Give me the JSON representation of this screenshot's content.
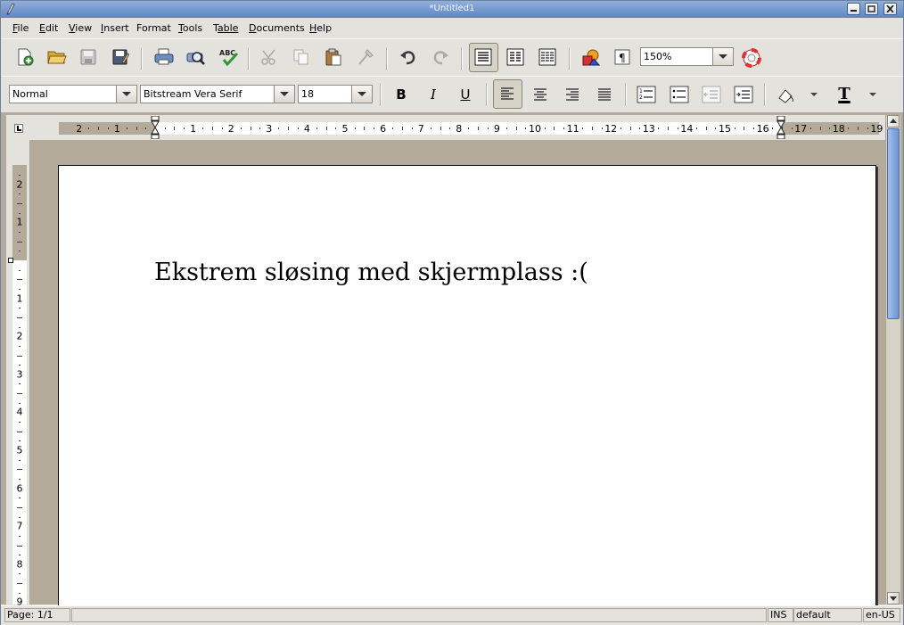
{
  "window": {
    "title": "*Untitled1"
  },
  "menu": {
    "items": [
      {
        "key": "F",
        "rest": "ile"
      },
      {
        "key": "E",
        "rest": "dit"
      },
      {
        "key": "V",
        "rest": "iew"
      },
      {
        "key": "I",
        "rest": "nsert"
      },
      {
        "key": "F",
        "rest": "ormat",
        "pre": "",
        "underline_index": 1
      },
      {
        "key": "T",
        "rest": "ools"
      },
      {
        "key": "T",
        "rest": "able"
      },
      {
        "key": "D",
        "rest": "ocuments"
      },
      {
        "key": "H",
        "rest": "elp"
      }
    ]
  },
  "toolbar": {
    "zoom_value": "150%",
    "icons": [
      "new-document-icon",
      "open-folder-icon",
      "save-icon",
      "save-as-icon",
      "print-icon",
      "print-preview-icon",
      "spell-check-icon",
      "cut-icon",
      "copy-icon",
      "paste-icon",
      "format-painter-icon",
      "undo-icon",
      "redo-icon",
      "normal-layout-icon",
      "web-layout-icon",
      "outline-layout-icon",
      "insert-picture-icon",
      "show-paragraph-marks-icon",
      "help-icon"
    ]
  },
  "format": {
    "style_value": "Normal",
    "font_value": "Bitstream Vera Serif",
    "size_value": "18",
    "bold_label": "B",
    "italic_label": "I",
    "underline_label": "U",
    "text_color_label": "T"
  },
  "ruler": {
    "horizontal_labels": [
      "2",
      "1",
      "1",
      "2",
      "3",
      "4",
      "5",
      "6",
      "7",
      "8",
      "9",
      "10",
      "11",
      "12",
      "13",
      "14",
      "15",
      "16",
      "17",
      "18",
      "19"
    ],
    "vertical_labels": [
      "2",
      "1",
      "1",
      "2",
      "3",
      "4",
      "5",
      "6",
      "7",
      "8",
      "9"
    ]
  },
  "document": {
    "text": "Ekstrem sløsing med skjermplass :("
  },
  "status": {
    "page": "Page: 1/1",
    "mode": "INS",
    "style": "default",
    "language": "en-US"
  },
  "colors": {
    "titlebar": "#5d86c2",
    "scroll_thumb": "#6a93d4",
    "ruler_margin": "#b3aa99"
  }
}
